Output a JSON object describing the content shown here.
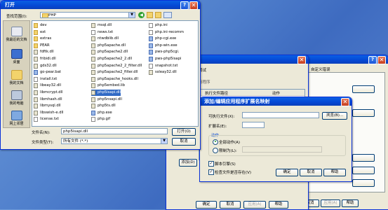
{
  "open_dialog": {
    "title": "打开",
    "lookin_label": "查找范围(I):",
    "lookin_value": "PHP",
    "nav": [
      "我最近的文档",
      "桌面",
      "我的文档",
      "我的电脑",
      "网上邻居"
    ],
    "files_col1": [
      {
        "name": "dev",
        "type": "folder"
      },
      {
        "name": "ext",
        "type": "folder"
      },
      {
        "name": "extras",
        "type": "folder"
      },
      {
        "name": "PEAR",
        "type": "folder"
      },
      {
        "name": "fdftk.dll",
        "type": "dll"
      },
      {
        "name": "fribidi.dll",
        "type": "dll"
      },
      {
        "name": "gds32.dll",
        "type": "dll"
      },
      {
        "name": "go-pear.bat",
        "type": "exe"
      },
      {
        "name": "install.txt",
        "type": "ini"
      },
      {
        "name": "libeay32.dll",
        "type": "dll"
      },
      {
        "name": "libmcrypt.dll",
        "type": "dll"
      },
      {
        "name": "libmhash.dll",
        "type": "dll"
      },
      {
        "name": "libmysql.dll",
        "type": "dll"
      },
      {
        "name": "libswish-e.dll",
        "type": "dll"
      },
      {
        "name": "license.txt",
        "type": "ini"
      }
    ],
    "files_col2": [
      {
        "name": "msql.dll",
        "type": "dll"
      },
      {
        "name": "news.txt",
        "type": "ini"
      },
      {
        "name": "ntwdblib.dll",
        "type": "dll"
      },
      {
        "name": "php5apache.dll",
        "type": "dll"
      },
      {
        "name": "php5apache2.dll",
        "type": "dll"
      },
      {
        "name": "php5apache2_2.dll",
        "type": "dll"
      },
      {
        "name": "php5apache2_2_filter.dll",
        "type": "dll"
      },
      {
        "name": "php5apache2_filter.dll",
        "type": "dll"
      },
      {
        "name": "php5apache_hooks.dll",
        "type": "dll"
      },
      {
        "name": "php5embed.lib",
        "type": "dll"
      },
      {
        "name": "php5isapi.dll",
        "type": "dll"
      },
      {
        "name": "php5nsapi.dll",
        "type": "dll"
      },
      {
        "name": "php5ts.dll",
        "type": "dll"
      },
      {
        "name": "php.exe",
        "type": "exe"
      },
      {
        "name": "php.gif",
        "type": "ini"
      }
    ],
    "files_col3": [
      {
        "name": "php.ini",
        "type": "ini"
      },
      {
        "name": "php.ini-recomm",
        "type": "ini"
      },
      {
        "name": "php-cgi.exe",
        "type": "exe"
      },
      {
        "name": "php-win.exe",
        "type": "exe"
      },
      {
        "name": "pws-php5cgi.",
        "type": "exe"
      },
      {
        "name": "pws-php5isapi",
        "type": "exe"
      },
      {
        "name": "snapshot.txt",
        "type": "ini"
      },
      {
        "name": "ssleay32.dll",
        "type": "dll"
      }
    ],
    "selected_file": "php5isapi.dll",
    "filename_label": "文件名(N):",
    "filename_value": "php5isapi.dll",
    "filetype_label": "文件类型(T):",
    "filetype_value": "所有文件 (*.*)",
    "open_button": "打开(O)",
    "cancel_button": "取消"
  },
  "app_config": {
    "tab": "调试",
    "app_label": "用程序",
    "col_path": "执行文件路径",
    "col_action": "动作",
    "add_button": "添加(D)",
    "ok": "确定",
    "cancel": "取消",
    "apply": "应用(A)",
    "help": "帮助"
  },
  "right_window": {
    "tab": "自定义错误",
    "ok": "确定",
    "cancel": "取消",
    "apply": "应用(A)",
    "help": "帮助"
  },
  "map_dialog": {
    "title": "添加/编辑应用程序扩展名映射",
    "exe_label": "可执行文件(X):",
    "browse_button": "浏览(B)...",
    "ext_label": "扩展名(E):",
    "actions_group": "动作",
    "all_verbs": "全部动作(A)",
    "limit_to": "限制为(L):",
    "script_engine": "脚本引擎(S)",
    "check_file": "检查文件是否存在(V)",
    "ok": "确定",
    "cancel": "取消",
    "help": "帮助"
  }
}
